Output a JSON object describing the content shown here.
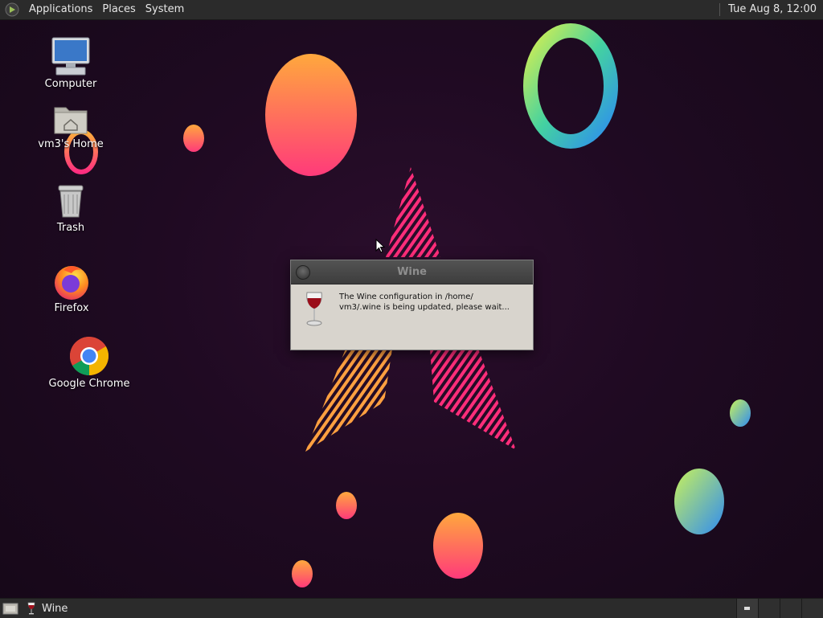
{
  "top_panel": {
    "menus": [
      "Applications",
      "Places",
      "System"
    ],
    "clock": "Tue Aug  8, 12:00"
  },
  "desktop_icons": [
    {
      "label": "Computer",
      "icon": "computer-icon"
    },
    {
      "label": "vm3's Home",
      "icon": "home-folder-icon"
    },
    {
      "label": "Trash",
      "icon": "trash-icon"
    },
    {
      "label": "Firefox",
      "icon": "firefox-icon"
    },
    {
      "label": "Google Chrome",
      "icon": "chrome-icon"
    }
  ],
  "dialog": {
    "title": "Wine",
    "message_line1": "The Wine configuration in /home/",
    "message_line2": "vm3/.wine is being updated, please wait...",
    "icon": "wine-glass-icon"
  },
  "taskbar": {
    "tasks": [
      {
        "label": "Wine",
        "icon": "wine-glass-icon"
      }
    ],
    "workspaces": 4
  },
  "colors": {
    "panel": "#2b2b2b",
    "dialog_bg": "#d8d4cd",
    "wallpaper_bg": "#1f0a22"
  }
}
